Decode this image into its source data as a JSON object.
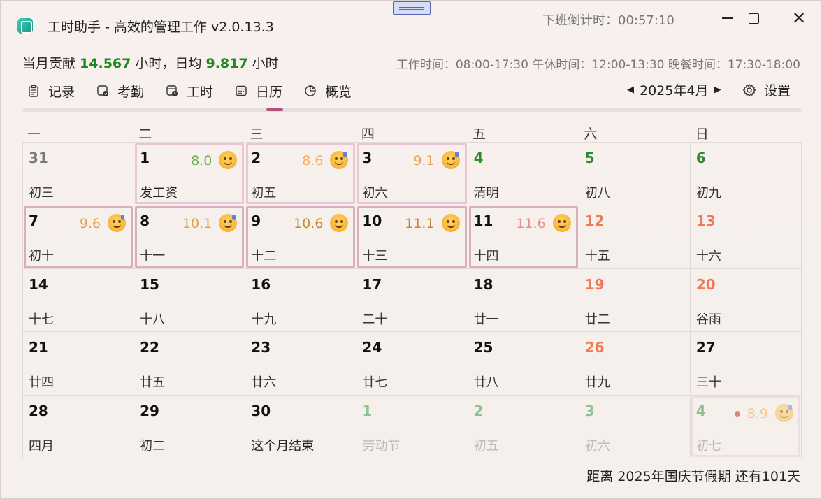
{
  "window": {
    "title": "工时助手 - 高效的管理工作 v2.0.13.3",
    "countdown": "下班倒计时：00:57:10"
  },
  "stats": {
    "prefix": "当月贡献 ",
    "month_hours": "14.567",
    "mid": " 小时，日均 ",
    "daily_avg": "9.817",
    "suffix": " 小时",
    "worktime": "工作时间：08:00-17:30 午休时间：12:00-13:30 晚餐时间：17:30-18:00"
  },
  "tabs": [
    {
      "label": "记录",
      "icon": "clipboard-icon"
    },
    {
      "label": "考勤",
      "icon": "attendance-icon"
    },
    {
      "label": "工时",
      "icon": "timesheet-icon"
    },
    {
      "label": "日历",
      "icon": "calendar-icon",
      "active": true
    },
    {
      "label": "概览",
      "icon": "pie-chart-icon"
    }
  ],
  "month_nav": {
    "label": "2025年4月"
  },
  "settings_label": "设置",
  "weekdays": [
    "一",
    "二",
    "三",
    "四",
    "五",
    "六",
    "日"
  ],
  "days": [
    {
      "day": "31",
      "lunar": "初三",
      "type": "other"
    },
    {
      "day": "1",
      "lunar": "发工资",
      "hours": "8.0",
      "hours_color": "#6ab04c",
      "highlight": "hl",
      "lunar_style": "link",
      "emoji": "smile-icon"
    },
    {
      "day": "2",
      "lunar": "初五",
      "hours": "8.6",
      "hours_color": "#f0b060",
      "highlight": "hl",
      "emoji": "sweat-smile-icon"
    },
    {
      "day": "3",
      "lunar": "初六",
      "hours": "9.1",
      "hours_color": "#e8a050",
      "highlight": "hl",
      "emoji": "sweat-smile-icon"
    },
    {
      "day": "4",
      "lunar": "清明",
      "type": "holiday"
    },
    {
      "day": "5",
      "lunar": "初八",
      "type": "holiday"
    },
    {
      "day": "6",
      "lunar": "初九",
      "type": "holiday"
    },
    {
      "day": "7",
      "lunar": "初十",
      "hours": "9.6",
      "hours_color": "#e8a050",
      "highlight": "hl-strong",
      "emoji": "drooling-icon"
    },
    {
      "day": "8",
      "lunar": "十一",
      "hours": "10.1",
      "hours_color": "#e0a040",
      "highlight": "hl-strong",
      "emoji": "drooling-icon"
    },
    {
      "day": "9",
      "lunar": "十二",
      "hours": "10.6",
      "hours_color": "#c58a30",
      "highlight": "hl-strong",
      "emoji": "neutral-icon"
    },
    {
      "day": "10",
      "lunar": "十三",
      "hours": "11.1",
      "hours_color": "#c58a30",
      "highlight": "hl-strong",
      "emoji": "neutral-icon"
    },
    {
      "day": "11",
      "lunar": "十四",
      "hours": "11.6",
      "hours_color": "#e89090",
      "highlight": "hl-strong",
      "emoji": "pensive-icon"
    },
    {
      "day": "12",
      "lunar": "十五",
      "type": "weekend"
    },
    {
      "day": "13",
      "lunar": "十六",
      "type": "weekend"
    },
    {
      "day": "14",
      "lunar": "十七"
    },
    {
      "day": "15",
      "lunar": "十八"
    },
    {
      "day": "16",
      "lunar": "十九"
    },
    {
      "day": "17",
      "lunar": "二十"
    },
    {
      "day": "18",
      "lunar": "廿一"
    },
    {
      "day": "19",
      "lunar": "廿二",
      "type": "weekend"
    },
    {
      "day": "20",
      "lunar": "谷雨",
      "type": "weekend"
    },
    {
      "day": "21",
      "lunar": "廿四"
    },
    {
      "day": "22",
      "lunar": "廿五"
    },
    {
      "day": "23",
      "lunar": "廿六"
    },
    {
      "day": "24",
      "lunar": "廿七"
    },
    {
      "day": "25",
      "lunar": "廿八"
    },
    {
      "day": "26",
      "lunar": "廿九",
      "type": "weekend"
    },
    {
      "day": "27",
      "lunar": "三十"
    },
    {
      "day": "28",
      "lunar": "四月"
    },
    {
      "day": "29",
      "lunar": "初二"
    },
    {
      "day": "30",
      "lunar": "这个月结束",
      "lunar_style": "link"
    },
    {
      "day": "1",
      "lunar": "劳动节",
      "type": "next",
      "lunar_style": "dim"
    },
    {
      "day": "2",
      "lunar": "初五",
      "type": "next",
      "lunar_style": "dim"
    },
    {
      "day": "3",
      "lunar": "初六",
      "type": "next",
      "lunar_style": "dim"
    },
    {
      "day": "4",
      "lunar": "初七",
      "type": "next",
      "lunar_style": "dim",
      "hours": "8.9",
      "hours_color": "#f3c98a",
      "highlight": "hl-pale",
      "emoji": "sweat-smile-icon",
      "emoji_pale": true,
      "dot": true
    }
  ],
  "footer": "距离 2025年国庆节假期 还有101天"
}
